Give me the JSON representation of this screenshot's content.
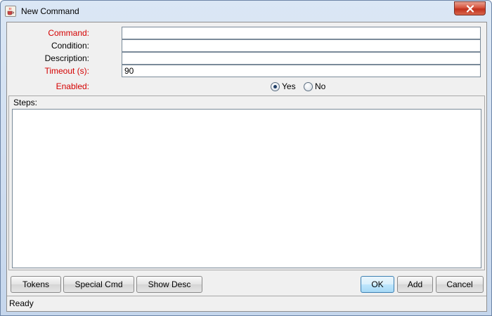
{
  "window": {
    "title": "New Command",
    "app_icon": "java-cup-icon",
    "close_icon": "close-icon"
  },
  "form": {
    "command": {
      "label": "Command:",
      "value": "",
      "required": true
    },
    "condition": {
      "label": "Condition:",
      "value": "",
      "required": false
    },
    "description": {
      "label": "Description:",
      "value": "",
      "required": false
    },
    "timeout": {
      "label": "Timeout (s):",
      "value": "90",
      "required": true
    },
    "enabled": {
      "label": "Enabled:",
      "required": true,
      "options": [
        {
          "label": "Yes",
          "selected": true
        },
        {
          "label": "No",
          "selected": false
        }
      ]
    }
  },
  "steps": {
    "label": "Steps:",
    "value": ""
  },
  "buttons": {
    "tokens": "Tokens",
    "special_cmd": "Special Cmd",
    "show_desc": "Show Desc",
    "ok": "OK",
    "add": "Add",
    "cancel": "Cancel"
  },
  "status": {
    "text": "Ready"
  },
  "colors": {
    "required_label": "#d40000",
    "close_button": "#c0311d",
    "default_button_border": "#3c7fb1"
  }
}
